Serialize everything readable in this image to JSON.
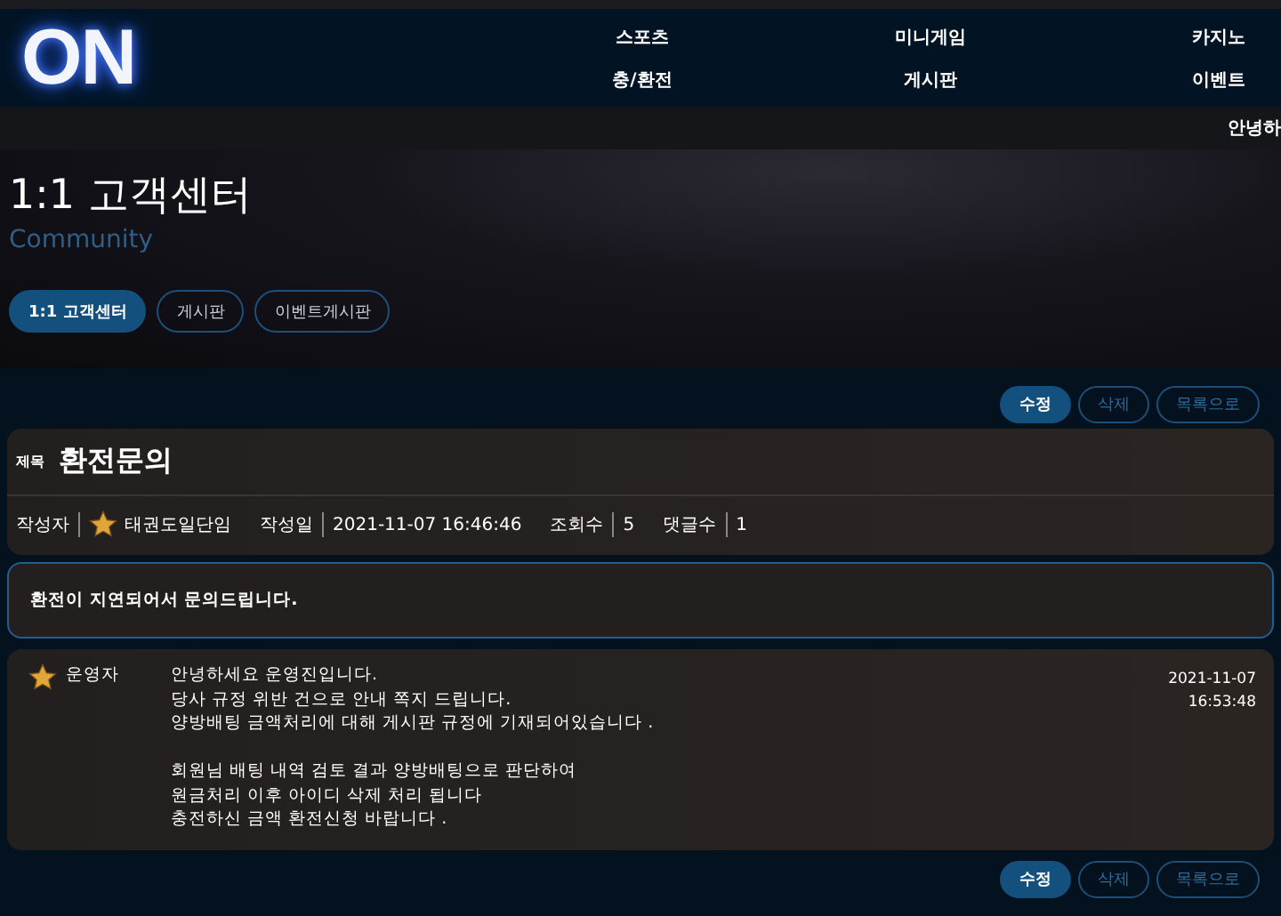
{
  "header": {
    "logo": "ON",
    "nav": [
      {
        "label": "스포츠"
      },
      {
        "label": "미니게임"
      },
      {
        "label": "카지노"
      },
      {
        "label": "충/환전"
      },
      {
        "label": "게시판"
      },
      {
        "label": "이벤트"
      }
    ],
    "greeting": "안녕하"
  },
  "hero": {
    "title": "1:1 고객센터",
    "subtitle": "Community",
    "tabs": [
      {
        "label": "1:1 고객센터",
        "selected": true
      },
      {
        "label": "게시판",
        "selected": false
      },
      {
        "label": "이벤트게시판",
        "selected": false
      }
    ]
  },
  "top_actions": [
    {
      "label": "수정",
      "selected": true
    },
    {
      "label": "삭제",
      "selected": false
    },
    {
      "label": "목록으로",
      "selected": false
    }
  ],
  "post": {
    "title_label": "제목",
    "title": "환전문의",
    "meta": [
      {
        "label": "작성자",
        "value": "태권도일단임",
        "kind": "author"
      },
      {
        "label": "작성일",
        "value": "2021-11-07 16:46:46",
        "kind": "text"
      },
      {
        "label": "조회수",
        "value": "5",
        "kind": "text"
      },
      {
        "label": "댓글수",
        "value": "1",
        "kind": "text"
      }
    ],
    "body": "환전이 지연되어서 문의드립니다."
  },
  "reply": {
    "author": "운영자",
    "paragraphs": [
      [
        "안녕하세요 운영진입니다.",
        "당사 규정 위반 건으로 안내 쪽지 드립니다.",
        "양방배팅 금액처리에 대해 게시판 규정에 기재되어있습니다 ."
      ],
      [
        "회원님 배팅 내역 검토 결과 양방배팅으로 판단하여",
        "원금처리 이후 아이디 삭제 처리 됩니다",
        "충전하신 금액 환전신청 바랍니다 ."
      ]
    ],
    "date": "2021-11-07",
    "time": "16:53:48"
  },
  "bottom_actions": [
    {
      "label": "수정",
      "selected": true
    },
    {
      "label": "삭제",
      "selected": false
    },
    {
      "label": "목록으로",
      "selected": false
    }
  ]
}
